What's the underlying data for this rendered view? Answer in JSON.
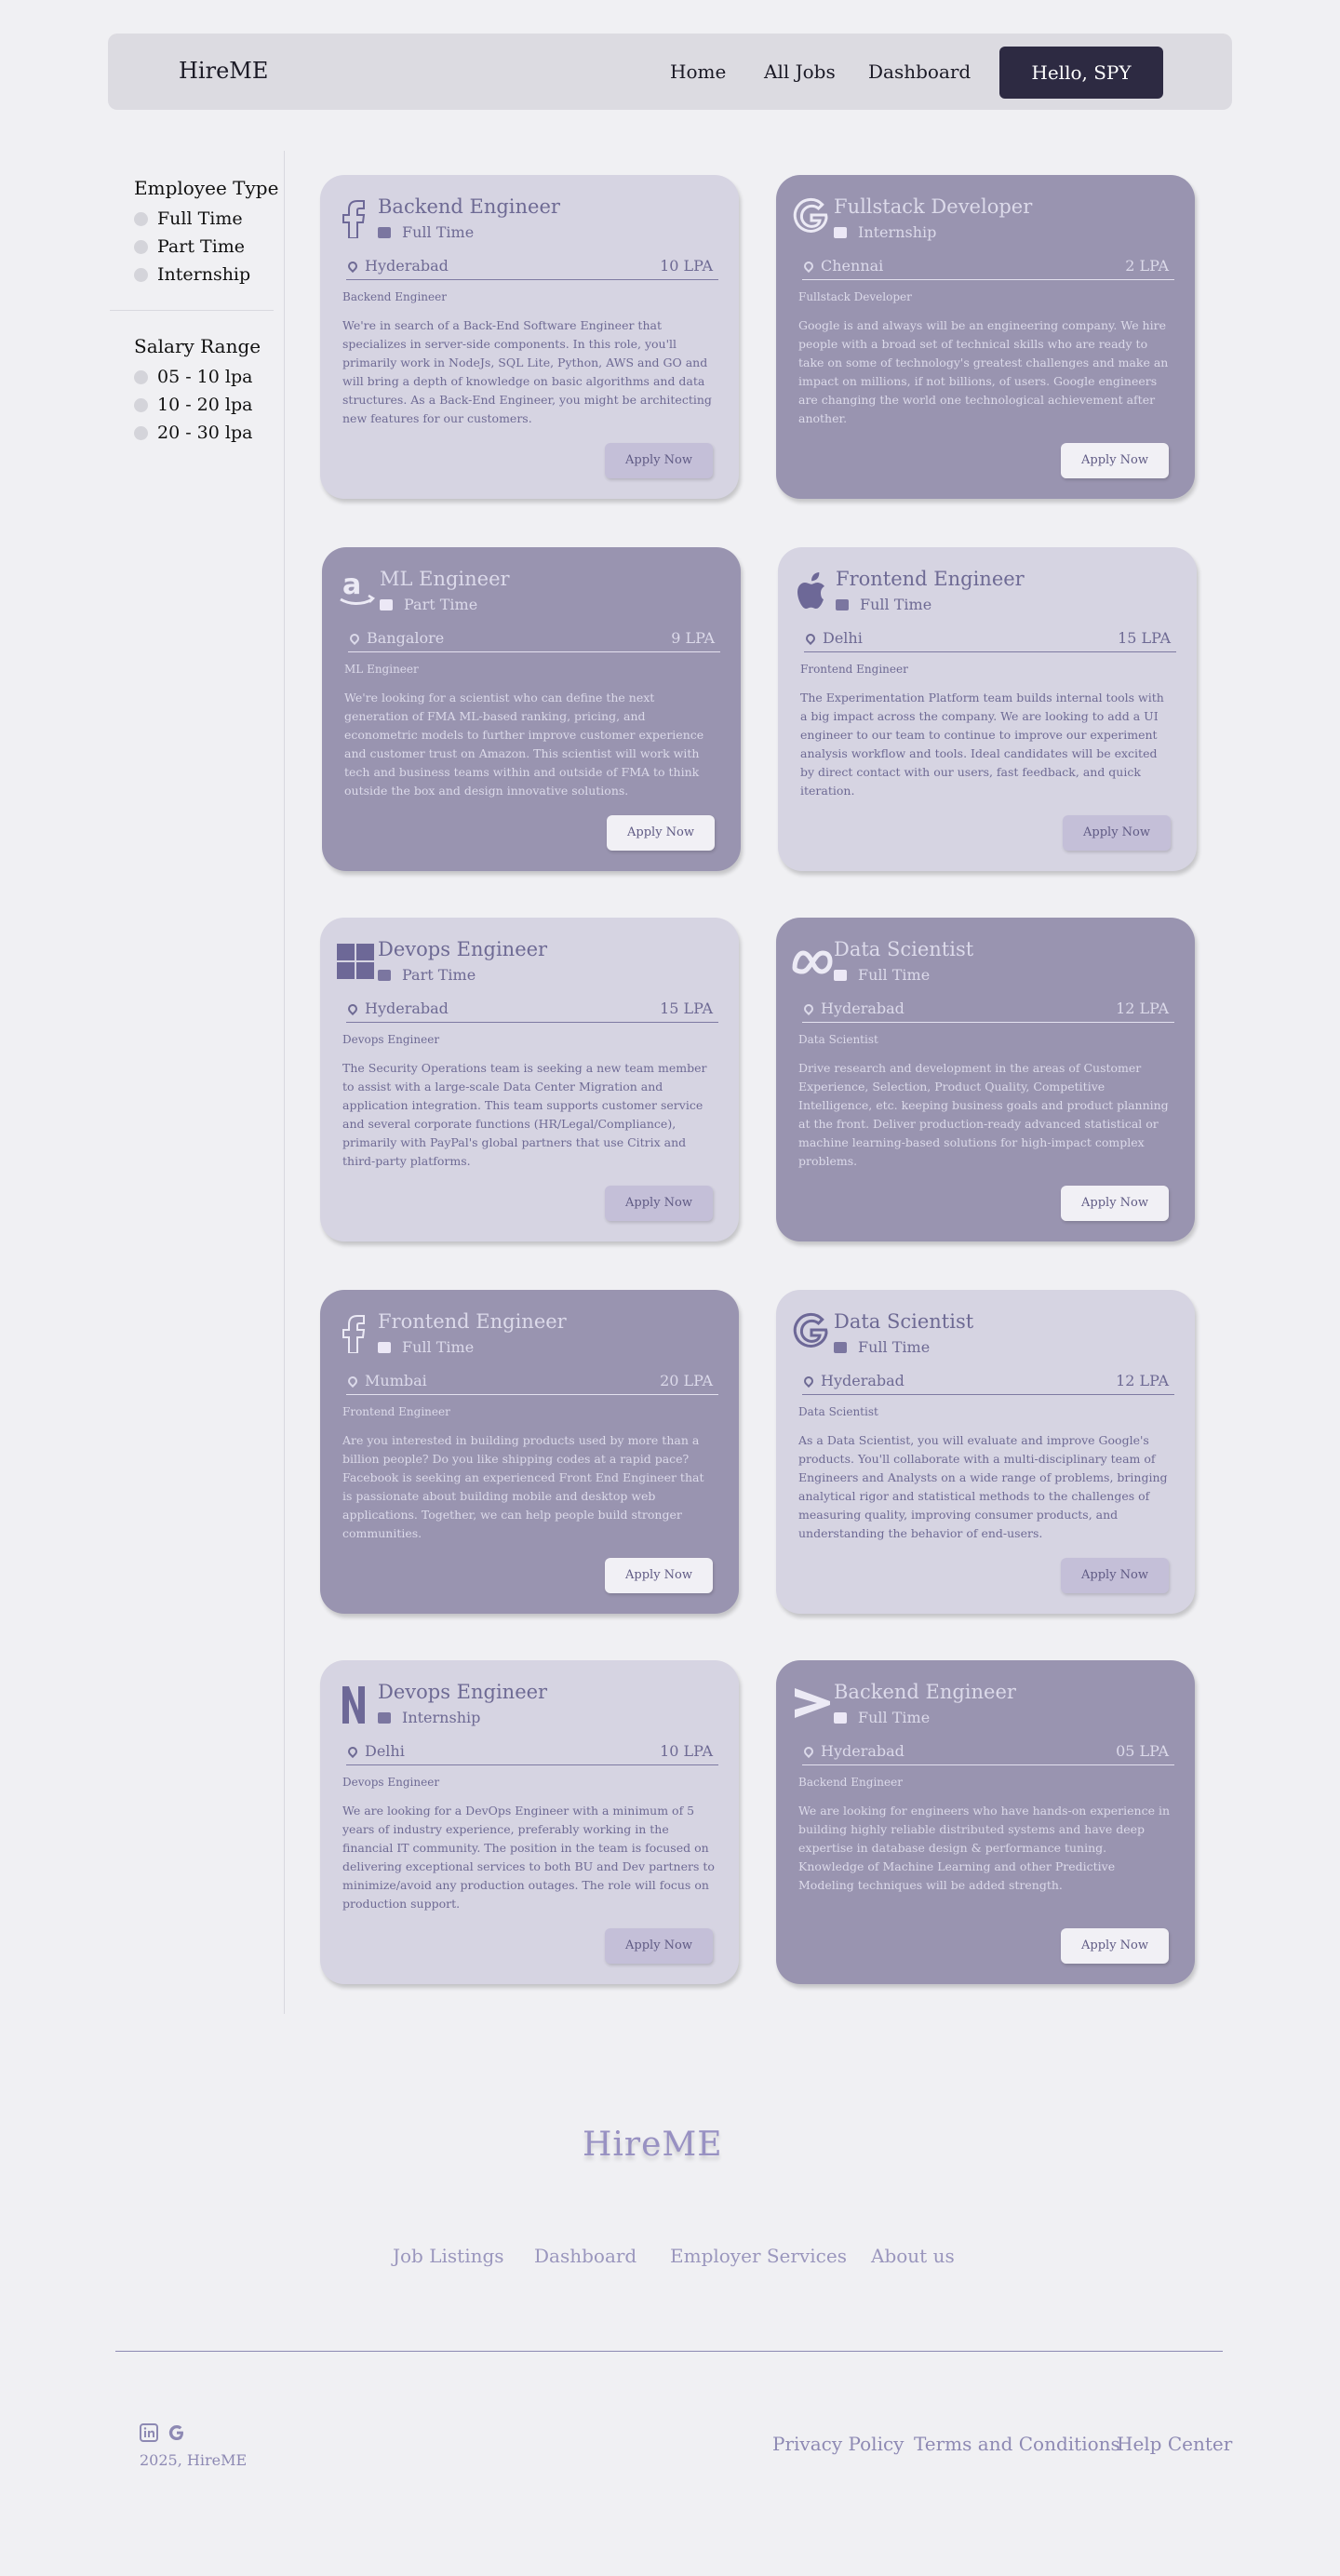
{
  "header": {
    "brand": "HireME",
    "nav": [
      "Home",
      "All Jobs",
      "Dashboard"
    ],
    "greeting": "Hello, SPY"
  },
  "sidebar": {
    "employee_type_title": "Employee Type",
    "employee_types": [
      "Full Time",
      "Part Time",
      "Internship"
    ],
    "salary_title": "Salary Range",
    "salary_ranges": [
      "05 - 10 lpa",
      "10 - 20 lpa",
      "20 - 30 lpa"
    ]
  },
  "jobs": [
    {
      "logo": "facebook-icon",
      "title": "Backend Engineer",
      "type": "Full Time",
      "location": "Hyderabad",
      "salary": "10 LPA",
      "subtitle": "Backend Engineer",
      "description": "We're in search of a Back-End Software Engineer that specializes in server-side components. In this role, you'll primarily work in NodeJs, SQL Lite, Python, AWS and GO and will bring a depth of knowledge on basic algorithms and data structures. As a Back-End Engineer, you might be architecting new features for our customers.",
      "apply": "Apply Now",
      "theme": "light"
    },
    {
      "logo": "google-icon",
      "title": "Fullstack Developer",
      "type": "Internship",
      "location": "Chennai",
      "salary": "2 LPA",
      "subtitle": "Fullstack Developer",
      "description": "Google is and always will be an engineering company. We hire people with a broad set of technical skills who are ready to take on some of technology's greatest challenges and make an impact on millions, if not billions, of users. Google engineers are changing the world one technological achievement after another.",
      "apply": "Apply Now",
      "theme": "dark"
    },
    {
      "logo": "amazon-icon",
      "title": "ML Engineer",
      "type": "Part Time",
      "location": "Bangalore",
      "salary": "9 LPA",
      "subtitle": "ML Engineer",
      "description": "We're looking for a scientist who can define the next generation of FMA ML-based ranking, pricing, and econometric models to further improve customer experience and customer trust on Amazon. This scientist will work with tech and business teams within and outside of FMA to think outside the box and design innovative solutions.",
      "apply": "Apply Now",
      "theme": "dark"
    },
    {
      "logo": "apple-icon",
      "title": "Frontend Engineer",
      "type": "Full Time",
      "location": "Delhi",
      "salary": "15 LPA",
      "subtitle": "Frontend Engineer",
      "description": "The Experimentation Platform team builds internal tools with a big impact across the company. We are looking to add a UI engineer to our team to continue to improve our experiment analysis workflow and tools. Ideal candidates will be excited by direct contact with our users, fast feedback, and quick iteration.",
      "apply": "Apply Now",
      "theme": "light"
    },
    {
      "logo": "windows-icon",
      "title": "Devops Engineer",
      "type": "Part Time",
      "location": "Hyderabad",
      "salary": "15 LPA",
      "subtitle": "Devops Engineer",
      "description": "The Security Operations team is seeking a new team member to assist with a large-scale Data Center Migration and application integration. This team supports customer service and several corporate functions (HR/Legal/Compliance), primarily with PayPal's global partners that use Citrix and third-party platforms.",
      "apply": "Apply Now",
      "theme": "light"
    },
    {
      "logo": "meta-icon",
      "title": "Data Scientist",
      "type": "Full Time",
      "location": "Hyderabad",
      "salary": "12 LPA",
      "subtitle": "Data Scientist",
      "description": "Drive research and development in the areas of Customer Experience, Selection, Product Quality, Competitive Intelligence, etc. keeping business goals and product planning at the front. Deliver production-ready advanced statistical or machine learning-based solutions for high-impact complex problems.",
      "apply": "Apply Now",
      "theme": "dark"
    },
    {
      "logo": "facebook-icon",
      "title": "Frontend Engineer",
      "type": "Full Time",
      "location": "Mumbai",
      "salary": "20 LPA",
      "subtitle": "Frontend Engineer",
      "description": "Are you interested in building products used by more than a billion people? Do you like shipping codes at a rapid pace? Facebook is seeking an experienced Front End Engineer that is passionate about building mobile and desktop web applications. Together, we can help people build stronger communities.",
      "apply": "Apply Now",
      "theme": "dark"
    },
    {
      "logo": "google-icon",
      "title": "Data Scientist",
      "type": "Full Time",
      "location": "Hyderabad",
      "salary": "12 LPA",
      "subtitle": "Data Scientist",
      "description": "As a Data Scientist, you will evaluate and improve Google's products. You'll collaborate with a multi-disciplinary team of Engineers and Analysts on a wide range of problems, bringing analytical rigor and statistical methods to the challenges of measuring quality, improving consumer products, and understanding the behavior of end-users.",
      "apply": "Apply Now",
      "theme": "light"
    },
    {
      "logo": "netflix-icon",
      "title": "Devops Engineer",
      "type": "Internship",
      "location": "Delhi",
      "salary": "10 LPA",
      "subtitle": "Devops Engineer",
      "description": "We are looking for a DevOps Engineer with a minimum of 5 years of industry experience, preferably working in the financial IT community. The position in the team is focused on delivering exceptional services to both BU and Dev partners to minimize/avoid any production outages. The role will focus on production support.",
      "apply": "Apply Now",
      "theme": "light"
    },
    {
      "logo": "prime-icon",
      "title": "Backend Engineer",
      "type": "Full Time",
      "location": "Hyderabad",
      "salary": "05 LPA",
      "subtitle": "Backend Engineer",
      "description": "We are looking for engineers who have hands-on experience in building highly reliable distributed systems and have deep expertise in database design & performance tuning. Knowledge of Machine Learning and other Predictive Modeling techniques will be added strength.",
      "apply": "Apply Now",
      "theme": "dark"
    }
  ],
  "footer": {
    "brand": "HireME",
    "links": [
      "Job Listings",
      "Dashboard",
      "Employer Services",
      "About us"
    ],
    "social": [
      "linkedin-icon",
      "google-icon"
    ],
    "copyright": "2025, HireME",
    "legal": [
      "Privacy Policy",
      "Terms and Conditions",
      "Help Center"
    ]
  }
}
